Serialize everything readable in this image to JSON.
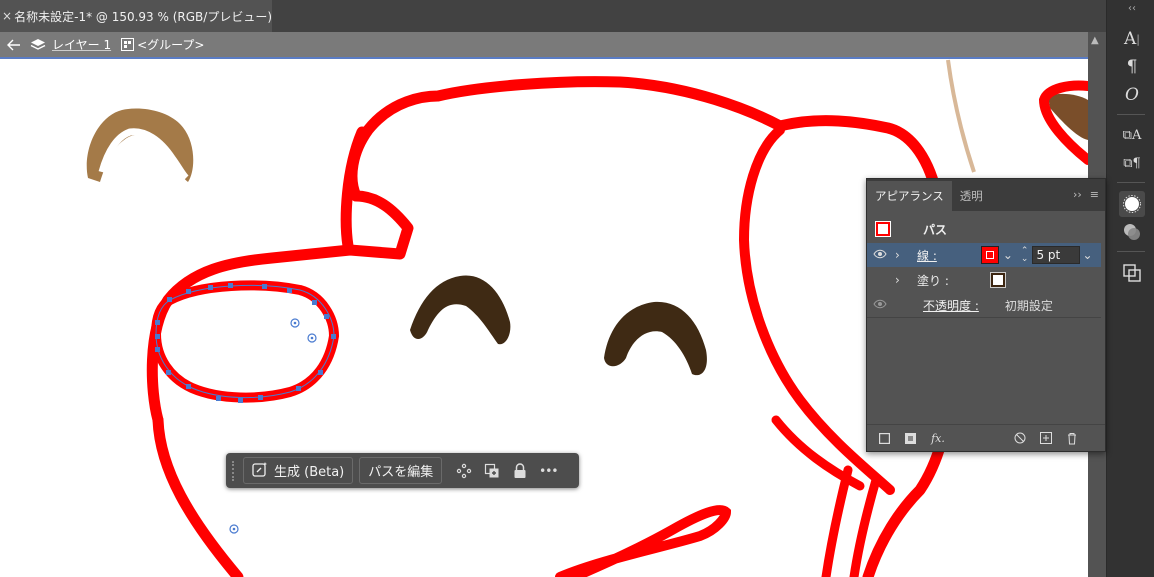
{
  "document_tab": {
    "close_glyph": "×",
    "title": "名称未設定-1* @ 150.93 % (RGB/プレビュー)"
  },
  "isolation_bar": {
    "layer_label": "レイヤー 1",
    "group_label": "<グループ>"
  },
  "right_toolbar": {
    "collapse_glyph": "‹‹",
    "tools": [
      "character-icon",
      "paragraph-icon",
      "opentype-icon",
      "character-styles-icon",
      "paragraph-styles-icon",
      "appearance-icon",
      "transparency-icon",
      "pathfinder-icon"
    ]
  },
  "appearance_panel": {
    "tabs": [
      "アピアランス",
      "透明"
    ],
    "menu_glyphs": {
      "expand": "››",
      "menu": "≡"
    },
    "path_label": "パス",
    "stroke_label": "線 :",
    "stroke_weight": "5 pt",
    "fill_label": "塗り :",
    "opacity_label": "不透明度 :",
    "opacity_value": "初期設定",
    "fx_label": "fx.",
    "colors": {
      "stroke": "#ff0000",
      "fill_swatch": "#3c2510"
    }
  },
  "context_bar": {
    "generate_label": "生成 (Beta)",
    "edit_path_label": "パスを編集",
    "more_glyph": "•••"
  },
  "canvas": {
    "colors": {
      "outline": "#ff0000",
      "eyes": "#3f2a14",
      "tan_stroke": "#a47a48",
      "selection": "#4a7bd0"
    }
  }
}
